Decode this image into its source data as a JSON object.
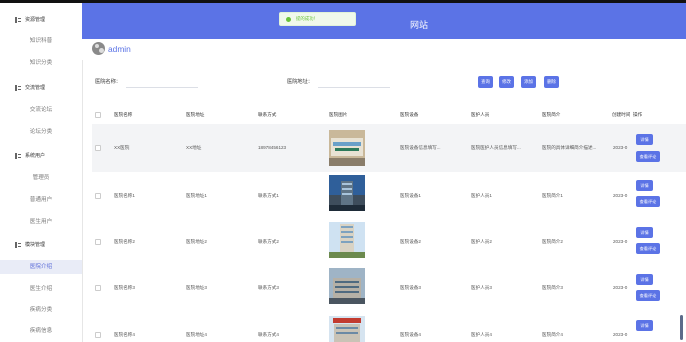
{
  "colors": {
    "accent": "#5b73e6",
    "toast_green": "#67c23a"
  },
  "sidebar": {
    "groups": [
      {
        "label": "资源管理",
        "icon": "grid-icon"
      },
      {
        "label": "交流管理",
        "icon": "grid-icon"
      },
      {
        "label": "系统用户",
        "icon": "grid-icon"
      },
      {
        "label": "模块管理",
        "icon": "grid-icon"
      }
    ],
    "items": [
      {
        "label": "知识科普"
      },
      {
        "label": "知识分类"
      },
      {
        "label": "交流论坛"
      },
      {
        "label": "论坛分类"
      },
      {
        "label": "管理员"
      },
      {
        "label": "普通用户"
      },
      {
        "label": "医生用户"
      },
      {
        "label": "医院介绍"
      },
      {
        "label": "医生介绍"
      },
      {
        "label": "疾病分类"
      },
      {
        "label": "疾病信息"
      }
    ]
  },
  "header": {
    "site_title": "网站"
  },
  "toast": {
    "text": "提的成功！"
  },
  "user": {
    "name": "admin"
  },
  "search": {
    "name_label": "医院名称：",
    "address_label": "医院地址：",
    "buttons": [
      "查询",
      "修改",
      "添加",
      "删除"
    ]
  },
  "table": {
    "columns": [
      "医院名称",
      "医院地址",
      "联系方式",
      "医院图片",
      "医院设备",
      "医护人员",
      "医院简介",
      "创建时间",
      "操作"
    ],
    "rows": [
      {
        "name": "XX医院",
        "address": "XX地址",
        "contact": "18978456123",
        "equipment": "医院设备信息填写...",
        "staff": "医院医护人员信息填写...",
        "intro": "医院的具体详细简介描述...",
        "created": "2023-0",
        "img": "sign"
      },
      {
        "name": "医院名称1",
        "address": "医院地址1",
        "contact": "联系方式1",
        "equipment": "医院设备1",
        "staff": "医护人员1",
        "intro": "医院简介1",
        "created": "2023-0",
        "img": "tower"
      },
      {
        "name": "医院名称2",
        "address": "医院地址2",
        "contact": "联系方式2",
        "equipment": "医院设备2",
        "staff": "医护人员2",
        "intro": "医院简介2",
        "created": "2023-0",
        "img": "tall"
      },
      {
        "name": "医院名称3",
        "address": "医院地址3",
        "contact": "联系方式3",
        "equipment": "医院设备3",
        "staff": "医护人员3",
        "intro": "医院简介3",
        "created": "2023-0",
        "img": "wide"
      },
      {
        "name": "医院名称4",
        "address": "医院地址4",
        "contact": "联系方式4",
        "equipment": "医院设备4",
        "staff": "医护人员4",
        "intro": "医院简介4",
        "created": "2023-0",
        "img": "red"
      }
    ],
    "actions": {
      "detail": "详情",
      "comments": "查看评论"
    }
  }
}
